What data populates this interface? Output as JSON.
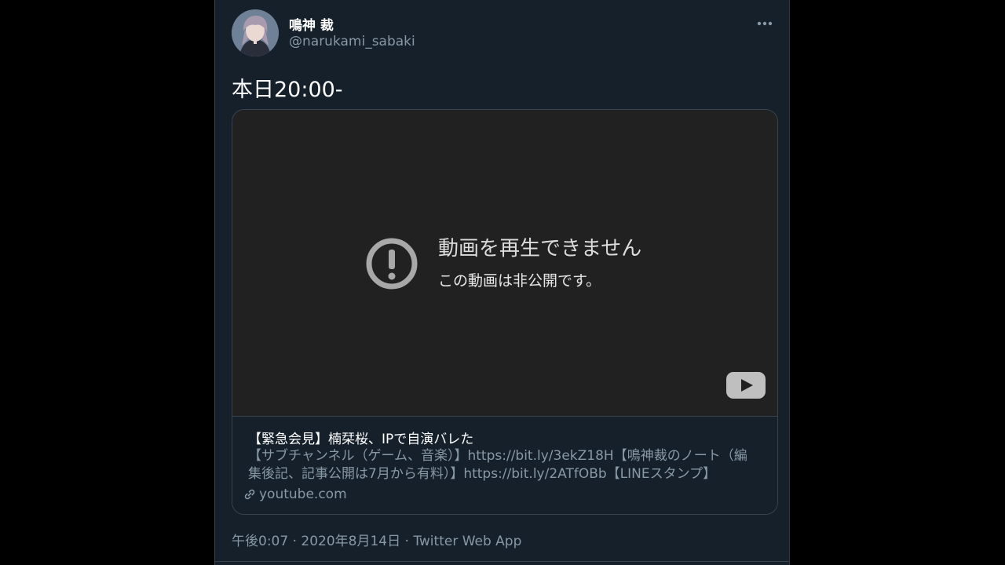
{
  "author": {
    "display_name": "鳴神 裁",
    "handle": "@narukami_sabaki"
  },
  "tweet": {
    "text": "本日20:00-",
    "timestamp": "午後0:07 · 2020年8月14日",
    "separator": " · ",
    "source": "Twitter Web App"
  },
  "card": {
    "player": {
      "error_title": "動画を再生できません",
      "error_message": "この動画は非公開です。"
    },
    "title": "【緊急会見】楠栞桜、IPで自演バレた",
    "description": "【サブチャンネル（ゲーム、音楽）】https://bit.ly/3ekZ18H【鳴神裁のノート（編集後記、記事公開は7月から有料）】https://bit.ly/2ATfOBb【LINEスタンプ】",
    "domain": "youtube.com"
  },
  "colors": {
    "background": "#15202b",
    "border": "#38444d",
    "secondary_text": "#8899a6",
    "player_background": "#212121"
  },
  "icons": {
    "more": "more-horizontal-icon",
    "error": "exclamation-circle-icon",
    "youtube": "youtube-logo-icon",
    "link": "link-icon"
  }
}
